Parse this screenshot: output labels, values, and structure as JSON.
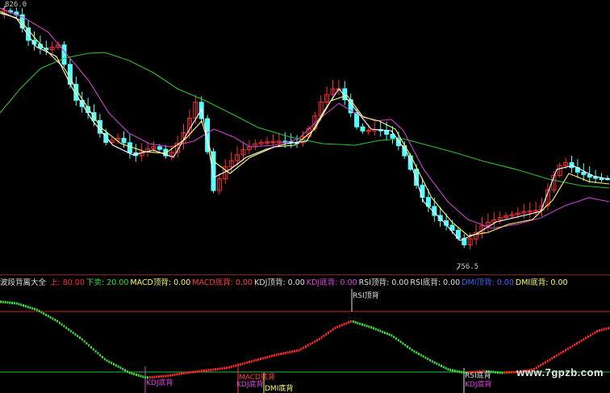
{
  "main": {
    "price_high_label": "826.0",
    "price_low_label": "756.5"
  },
  "indicator": {
    "name": "波段背离大全",
    "params": [
      {
        "label": "上: 80.00",
        "color": "#ff2a2a"
      },
      {
        "label": "下卖: 20.00",
        "color": "#30e030"
      },
      {
        "label": "MACD顶背: 0.00",
        "color": "#ffff66"
      },
      {
        "label": "MACD底背: 0.00",
        "color": "#ff4040"
      },
      {
        "label": "KDJ顶背: 0.00",
        "color": "#e0e0e0"
      },
      {
        "label": "KDJ底背: 0.00",
        "color": "#e040e0"
      },
      {
        "label": "RSI顶背: 0.00",
        "color": "#e0e0e0"
      },
      {
        "label": "RSI底背: 0.00",
        "color": "#e0e0e0"
      },
      {
        "label": "DMI顶背: 0.00",
        "color": "#4060ff"
      },
      {
        "label": "DMI底背: 0.00",
        "color": "#ffff66"
      }
    ],
    "signals": [
      {
        "label": "RSI顶背",
        "color": "#e0e0e0"
      },
      {
        "label": "KDJ底背",
        "color": "#e040e0"
      },
      {
        "label": "MACD底背",
        "color": "#ff4040"
      },
      {
        "label": "KDJ底背",
        "color": "#e040e0"
      },
      {
        "label": "DMI底背",
        "color": "#ffff66"
      },
      {
        "label": "RSI底背",
        "color": "#e0e0e0"
      },
      {
        "label": "KDJ底背",
        "color": "#e040e0"
      }
    ]
  },
  "watermark": "www.7gpzb.com",
  "colors": {
    "up_candle": "#ff3030",
    "down_candle": "#54ffff",
    "ma_short": "#ffffff",
    "ma_mid": "#ffff66",
    "ma_long": "#d040d0",
    "ma_very_long": "#30c030",
    "osc_up": "#ff2a2a",
    "osc_down": "#40e040",
    "line_80": "#d02020",
    "line_20": "#30c030"
  }
}
